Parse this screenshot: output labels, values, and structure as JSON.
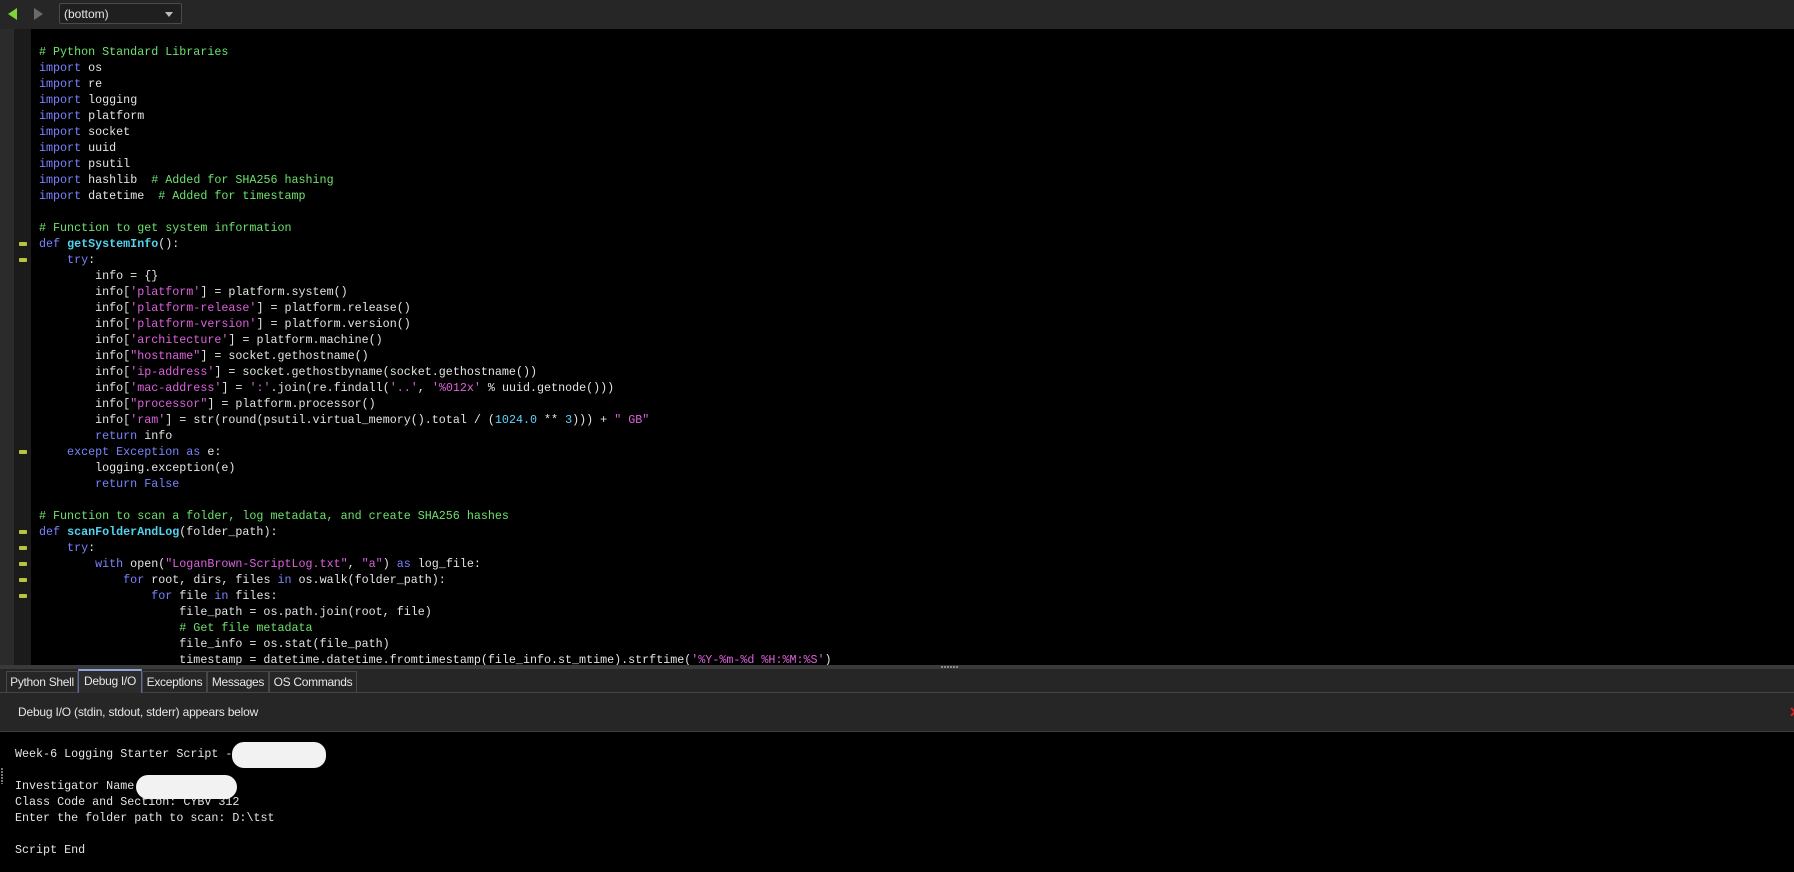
{
  "toolbar": {
    "back_icon": "back-arrow-icon",
    "forward_icon": "forward-arrow-icon",
    "scope_selector": "(bottom)"
  },
  "colors": {
    "keyword": "#7b82ff",
    "comment": "#6ce26c",
    "string": "#dc62dc",
    "function": "#52d3ef",
    "number": "#5fd2ff",
    "fold_marker": "#b8c43c"
  },
  "editor": {
    "lines": [
      {
        "fold": false,
        "tokens": [
          [
            "c",
            "# Python Standard Libraries"
          ]
        ]
      },
      {
        "fold": false,
        "tokens": [
          [
            "k",
            "import"
          ],
          [
            "t",
            " os"
          ]
        ]
      },
      {
        "fold": false,
        "tokens": [
          [
            "k",
            "import"
          ],
          [
            "t",
            " re"
          ]
        ]
      },
      {
        "fold": false,
        "tokens": [
          [
            "k",
            "import"
          ],
          [
            "t",
            " logging"
          ]
        ]
      },
      {
        "fold": false,
        "tokens": [
          [
            "k",
            "import"
          ],
          [
            "t",
            " platform"
          ]
        ]
      },
      {
        "fold": false,
        "tokens": [
          [
            "k",
            "import"
          ],
          [
            "t",
            " socket"
          ]
        ]
      },
      {
        "fold": false,
        "tokens": [
          [
            "k",
            "import"
          ],
          [
            "t",
            " uuid"
          ]
        ]
      },
      {
        "fold": false,
        "tokens": [
          [
            "k",
            "import"
          ],
          [
            "t",
            " psutil"
          ]
        ]
      },
      {
        "fold": false,
        "tokens": [
          [
            "k",
            "import"
          ],
          [
            "t",
            " hashlib  "
          ],
          [
            "c",
            "# Added for SHA256 hashing"
          ]
        ]
      },
      {
        "fold": false,
        "tokens": [
          [
            "k",
            "import"
          ],
          [
            "t",
            " datetime  "
          ],
          [
            "c",
            "# Added for timestamp"
          ]
        ]
      },
      {
        "fold": false,
        "tokens": []
      },
      {
        "fold": false,
        "tokens": [
          [
            "c",
            "# Function to get system information"
          ]
        ]
      },
      {
        "fold": true,
        "tokens": [
          [
            "k",
            "def "
          ],
          [
            "f",
            "getSystemInfo"
          ],
          [
            "t",
            "():"
          ]
        ]
      },
      {
        "fold": true,
        "tokens": [
          [
            "k",
            "    try"
          ],
          [
            "t",
            ":"
          ]
        ]
      },
      {
        "fold": false,
        "tokens": [
          [
            "t",
            "        info = {}"
          ]
        ]
      },
      {
        "fold": false,
        "tokens": [
          [
            "t",
            "        info["
          ],
          [
            "s",
            "'platform'"
          ],
          [
            "t",
            "] = platform.system()"
          ]
        ]
      },
      {
        "fold": false,
        "tokens": [
          [
            "t",
            "        info["
          ],
          [
            "s",
            "'platform-release'"
          ],
          [
            "t",
            "] = platform.release()"
          ]
        ]
      },
      {
        "fold": false,
        "tokens": [
          [
            "t",
            "        info["
          ],
          [
            "s",
            "'platform-version'"
          ],
          [
            "t",
            "] = platform.version()"
          ]
        ]
      },
      {
        "fold": false,
        "tokens": [
          [
            "t",
            "        info["
          ],
          [
            "s",
            "'architecture'"
          ],
          [
            "t",
            "] = platform.machine()"
          ]
        ]
      },
      {
        "fold": false,
        "tokens": [
          [
            "t",
            "        info["
          ],
          [
            "s",
            "\"hostname\""
          ],
          [
            "t",
            "] = socket.gethostname()"
          ]
        ]
      },
      {
        "fold": false,
        "tokens": [
          [
            "t",
            "        info["
          ],
          [
            "s",
            "'ip-address'"
          ],
          [
            "t",
            "] = socket.gethostbyname(socket.gethostname())"
          ]
        ]
      },
      {
        "fold": false,
        "tokens": [
          [
            "t",
            "        info["
          ],
          [
            "s",
            "'mac-address'"
          ],
          [
            "t",
            "] = "
          ],
          [
            "s",
            "':'"
          ],
          [
            "t",
            ".join(re.findall("
          ],
          [
            "s",
            "'..'"
          ],
          [
            "t",
            ", "
          ],
          [
            "s",
            "'%012x'"
          ],
          [
            "t",
            " % uuid.getnode()))"
          ]
        ]
      },
      {
        "fold": false,
        "tokens": [
          [
            "t",
            "        info["
          ],
          [
            "s",
            "\"processor\""
          ],
          [
            "t",
            "] = platform.processor()"
          ]
        ]
      },
      {
        "fold": false,
        "tokens": [
          [
            "t",
            "        info["
          ],
          [
            "s",
            "'ram'"
          ],
          [
            "t",
            "] = str(round(psutil.virtual_memory().total / ("
          ],
          [
            "n",
            "1024.0"
          ],
          [
            "t",
            " ** "
          ],
          [
            "n",
            "3"
          ],
          [
            "t",
            "))) + "
          ],
          [
            "s",
            "\" GB\""
          ]
        ]
      },
      {
        "fold": false,
        "tokens": [
          [
            "k",
            "        return"
          ],
          [
            "t",
            " info"
          ]
        ]
      },
      {
        "fold": true,
        "tokens": [
          [
            "k",
            "    except Exception as"
          ],
          [
            "t",
            " e:"
          ]
        ]
      },
      {
        "fold": false,
        "tokens": [
          [
            "t",
            "        logging.exception(e)"
          ]
        ]
      },
      {
        "fold": false,
        "tokens": [
          [
            "k",
            "        return False"
          ]
        ]
      },
      {
        "fold": false,
        "tokens": []
      },
      {
        "fold": false,
        "tokens": [
          [
            "c",
            "# Function to scan a folder, log metadata, and create SHA256 hashes"
          ]
        ]
      },
      {
        "fold": true,
        "tokens": [
          [
            "k",
            "def "
          ],
          [
            "f",
            "scanFolderAndLog"
          ],
          [
            "t",
            "(folder_path):"
          ]
        ]
      },
      {
        "fold": true,
        "tokens": [
          [
            "k",
            "    try"
          ],
          [
            "t",
            ":"
          ]
        ]
      },
      {
        "fold": true,
        "tokens": [
          [
            "k",
            "        with"
          ],
          [
            "t",
            " open("
          ],
          [
            "s",
            "\"LoganBrown-ScriptLog.txt\""
          ],
          [
            "t",
            ", "
          ],
          [
            "s",
            "\"a\""
          ],
          [
            "t",
            ") "
          ],
          [
            "k",
            "as"
          ],
          [
            "t",
            " log_file:"
          ]
        ]
      },
      {
        "fold": true,
        "tokens": [
          [
            "k",
            "            for"
          ],
          [
            "t",
            " root, dirs, files "
          ],
          [
            "k",
            "in"
          ],
          [
            "t",
            " os.walk(folder_path):"
          ]
        ]
      },
      {
        "fold": true,
        "tokens": [
          [
            "k",
            "                for"
          ],
          [
            "t",
            " file "
          ],
          [
            "k",
            "in"
          ],
          [
            "t",
            " files:"
          ]
        ]
      },
      {
        "fold": false,
        "tokens": [
          [
            "t",
            "                    file_path = os.path.join(root, file)"
          ]
        ]
      },
      {
        "fold": false,
        "tokens": [
          [
            "c",
            "                    # Get file metadata"
          ]
        ]
      },
      {
        "fold": false,
        "tokens": [
          [
            "t",
            "                    file_info = os.stat(file_path)"
          ]
        ]
      },
      {
        "fold": false,
        "tokens": [
          [
            "t",
            "                    timestamp = datetime.datetime.fromtimestamp(file_info.st_mtime).strftime("
          ],
          [
            "s",
            "'%Y-%m-%d %H:%M:%S'"
          ],
          [
            "t",
            ")"
          ]
        ]
      }
    ]
  },
  "tabs": [
    {
      "label": "Python Shell",
      "active": false
    },
    {
      "label": "Debug I/O",
      "active": true
    },
    {
      "label": "Exceptions",
      "active": false
    },
    {
      "label": "Messages",
      "active": false
    },
    {
      "label": "OS Commands",
      "active": false
    }
  ],
  "debug_io": {
    "header": "Debug I/O (stdin, stdout, stderr) appears below",
    "lines": [
      "Week-6 Logging Starter Script - ",
      "",
      "Investigator Name",
      "Class Code and Section: CYBV 312",
      "Enter the folder path to scan: D:\\tst",
      "",
      "Script End"
    ]
  }
}
